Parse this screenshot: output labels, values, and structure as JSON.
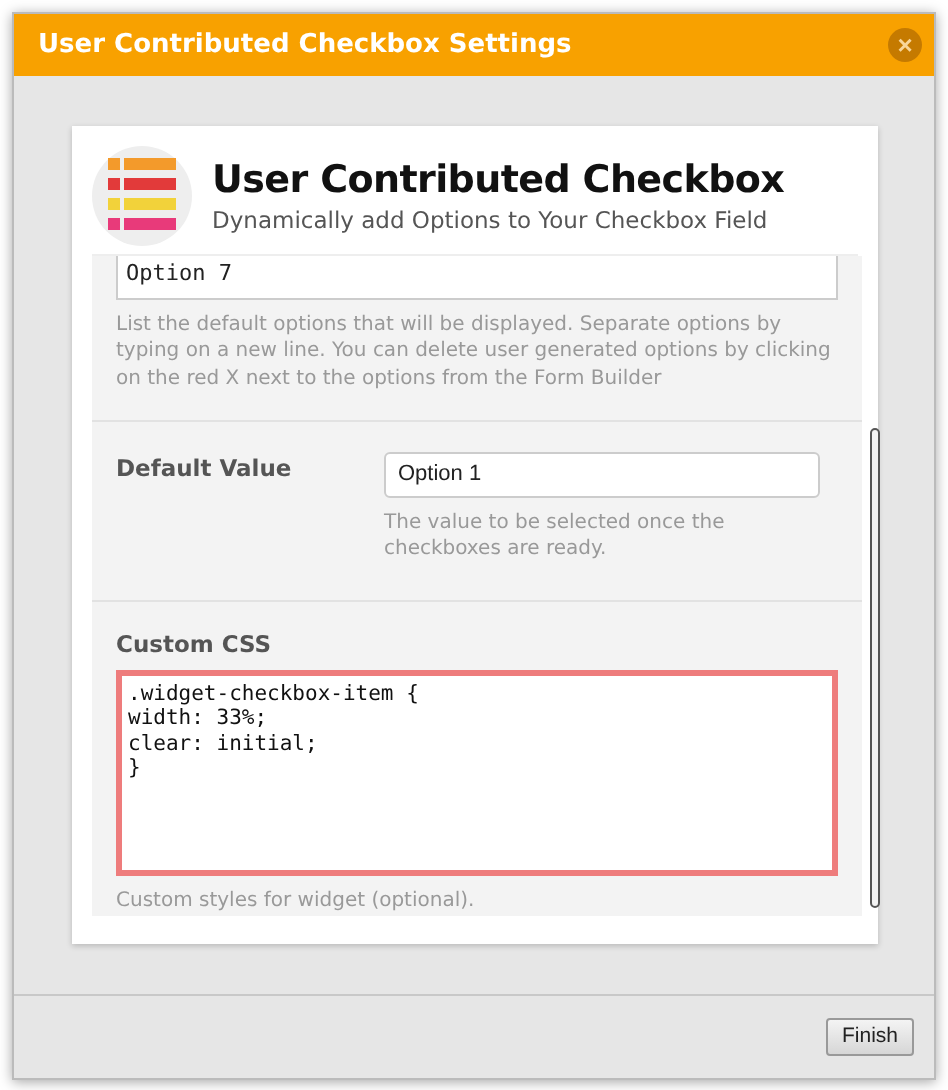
{
  "window": {
    "title": "User Contributed Checkbox Settings",
    "close": "×"
  },
  "widget": {
    "title": "User Contributed Checkbox",
    "subtitle": "Dynamically add Options to Your Checkbox Field"
  },
  "options_field": {
    "value": "Option 7",
    "help": "List the default options that will be displayed. Separate options by typing on a new line. You can delete user generated options by clicking on the red X next to the options from the Form Builder"
  },
  "default_value": {
    "label": "Default Value",
    "value": "Option 1",
    "help": "The value to be selected once the checkboxes are ready."
  },
  "custom_css": {
    "label": "Custom CSS",
    "value": ".widget-checkbox-item {\nwidth: 33%;\nclear: initial;\n}",
    "help": "Custom styles for widget (optional).",
    "invalid": true
  },
  "buttons": [
    "Finish"
  ]
}
